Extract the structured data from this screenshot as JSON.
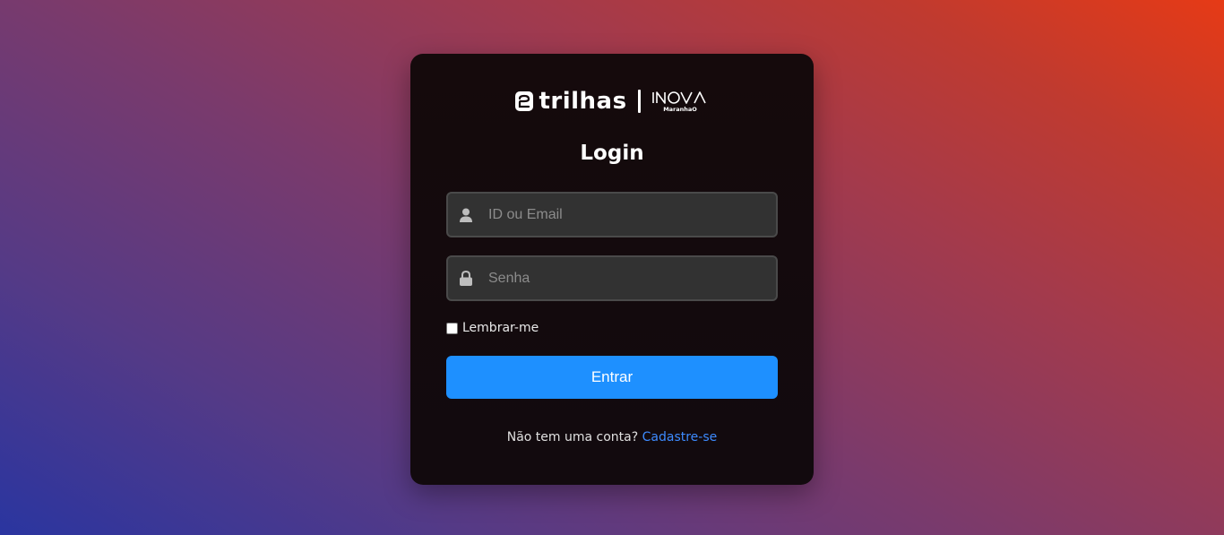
{
  "logo": {
    "brand_text": "trilhas",
    "partner_text": "INOVA",
    "partner_sub": "MaranhaO"
  },
  "form": {
    "title": "Login",
    "username_placeholder": "ID ou Email",
    "password_placeholder": "Senha",
    "remember_label": "Lembrar-me",
    "remember_checked": false,
    "submit_label": "Entrar"
  },
  "footer": {
    "prompt": "Não tem uma conta?",
    "signup_link": "Cadastre-se"
  },
  "colors": {
    "accent": "#1e90ff",
    "link": "#3d8bff",
    "card": "#150a0c"
  },
  "icons": {
    "username": "user-icon",
    "password": "lock-icon"
  }
}
